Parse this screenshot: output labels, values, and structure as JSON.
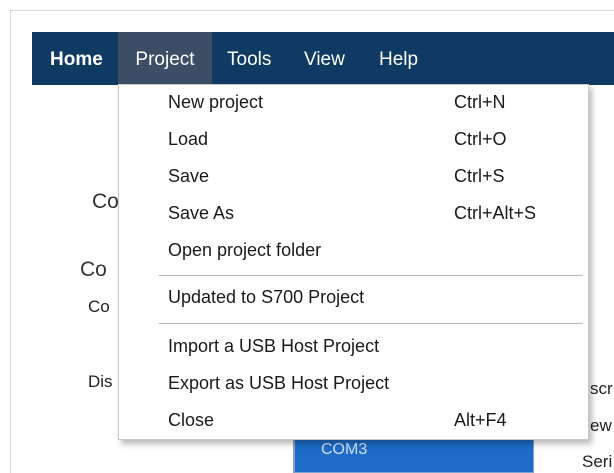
{
  "menubar": {
    "items": [
      {
        "label": "Home"
      },
      {
        "label": "Project"
      },
      {
        "label": "Tools"
      },
      {
        "label": "View"
      },
      {
        "label": "Help"
      }
    ],
    "active": "Project"
  },
  "project_menu": {
    "items": [
      {
        "label": "New project",
        "shortcut": "Ctrl+N"
      },
      {
        "label": "Load",
        "shortcut": "Ctrl+O"
      },
      {
        "label": "Save",
        "shortcut": "Ctrl+S"
      },
      {
        "label": "Save As",
        "shortcut": "Ctrl+Alt+S"
      },
      {
        "label": "Open project folder",
        "shortcut": ""
      },
      {
        "label": "Updated to S700 Project",
        "shortcut": ""
      },
      {
        "label": "Import a USB Host Project",
        "shortcut": ""
      },
      {
        "label": "Export as USB Host Project",
        "shortcut": ""
      },
      {
        "label": "Close",
        "shortcut": "Alt+F4"
      }
    ]
  },
  "background": {
    "fragments": [
      "Co",
      "Co",
      "Co",
      "Dis",
      "COM3",
      "scr",
      "ew",
      "Seri"
    ]
  },
  "colors": {
    "menubar_bg": "#0e3a63",
    "menubar_active_bg": "#3b4e66",
    "selection_bg": "#1e6cc8"
  }
}
